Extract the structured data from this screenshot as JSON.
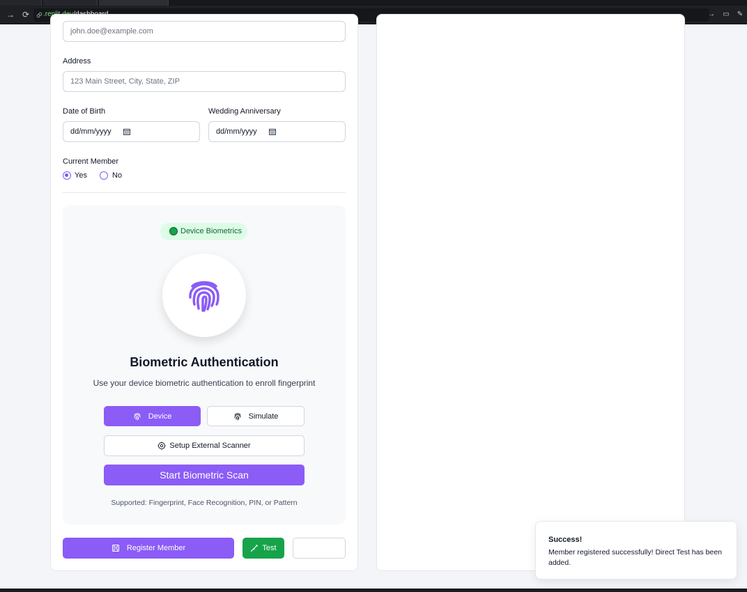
{
  "browser": {
    "url_domain": ".replit.dev",
    "url_path": "/dashboard"
  },
  "form": {
    "email_placeholder": "john.doe@example.com",
    "address_label": "Address",
    "address_placeholder": "123 Main Street, City, State, ZIP",
    "dob_label": "Date of Birth",
    "dob_value": "dd/mm/yyyy",
    "anniversary_label": "Wedding Anniversary",
    "anniversary_value": "dd/mm/yyyy",
    "current_member_label": "Current Member",
    "current_member_options": [
      "Yes",
      "No"
    ],
    "current_member_selected": "Yes"
  },
  "biometric": {
    "badge": "Device Biometrics",
    "title": "Biometric Authentication",
    "description": "Use your device biometric authentication to enroll fingerprint",
    "device_button": "Device",
    "simulate_button": "Simulate",
    "external_button": "Setup External Scanner",
    "scan_button": "Start Biometric Scan",
    "supported": "Supported: Fingerprint, Face Recognition, PIN, or Pattern"
  },
  "actions": {
    "register_button": "Register Member",
    "test_button": "Test"
  },
  "toast": {
    "title": "Success!",
    "message": "Member registered successfully! Direct Test has been added."
  },
  "colors": {
    "accent": "#8b5cf6",
    "success": "#16a34a",
    "badge_bg": "#dcfce7"
  }
}
